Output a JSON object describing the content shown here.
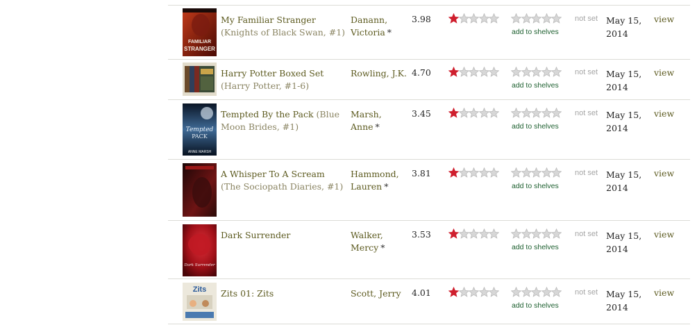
{
  "books": [
    {
      "title": "My Familiar Stranger",
      "series": "(Knights of Black Swan, #1)",
      "author": "Danann, Victoria",
      "author_marker": "*",
      "avg_rating": "3.98",
      "my_rating": 1,
      "shelf_label": "add to shelves",
      "date_read": "not set",
      "date_added": "May 15, 2014",
      "action": "view",
      "cover_label": "FAMILIAR STRANGER",
      "cover_colors": [
        "#6a1008",
        "#c23b1a"
      ]
    },
    {
      "title": "Harry Potter Boxed Set",
      "series": "(Harry Potter, #1-6)",
      "author": "Rowling, J.K.",
      "author_marker": "",
      "avg_rating": "4.70",
      "my_rating": 1,
      "shelf_label": "add to shelves",
      "date_read": "not set",
      "date_added": "May 15, 2014",
      "action": "view",
      "cover_label": "",
      "cover_colors": [
        "#dcd6c2",
        "#3a4a3a"
      ]
    },
    {
      "title": "Tempted By the Pack",
      "series": "(Blue Moon Brides, #1)",
      "author": "Marsh, Anne",
      "author_marker": "*",
      "avg_rating": "3.45",
      "my_rating": 1,
      "shelf_label": "add to shelves",
      "date_read": "not set",
      "date_added": "May 15, 2014",
      "action": "view",
      "cover_label": "ANNE MARSH",
      "cover_colors": [
        "#0a1a2e",
        "#5a7fa8"
      ]
    },
    {
      "title": "A Whisper To A Scream",
      "series": "(The Sociopath Diaries, #1)",
      "author": "Hammond, Lauren",
      "author_marker": "*",
      "avg_rating": "3.81",
      "my_rating": 1,
      "shelf_label": "add to shelves",
      "date_read": "not set",
      "date_added": "May 15, 2014",
      "action": "view",
      "cover_label": "",
      "cover_colors": [
        "#1a0808",
        "#7a1a1a"
      ]
    },
    {
      "title": "Dark Surrender",
      "series": "",
      "author": "Walker, Mercy",
      "author_marker": "*",
      "avg_rating": "3.53",
      "my_rating": 1,
      "shelf_label": "add to shelves",
      "date_read": "not set",
      "date_added": "May 15, 2014",
      "action": "view",
      "cover_label": "Dark Surrender",
      "cover_colors": [
        "#6a0a0a",
        "#d4202a"
      ]
    },
    {
      "title": "Zits 01: Zits",
      "series": "",
      "author": "Scott, Jerry",
      "author_marker": "",
      "avg_rating": "4.01",
      "my_rating": 1,
      "shelf_label": "add to shelves",
      "date_read": "not set",
      "date_added": "May 15, 2014",
      "action": "view",
      "cover_label": "Zits",
      "cover_colors": [
        "#e8e4d8",
        "#2a5a9a"
      ]
    }
  ],
  "colors": {
    "star_filled": "#cf1f2e",
    "star_empty": "#d7d7d7",
    "star_outline": "#b9b9b9",
    "link": "#5c5a1f",
    "shelf_link": "#1e6030"
  }
}
